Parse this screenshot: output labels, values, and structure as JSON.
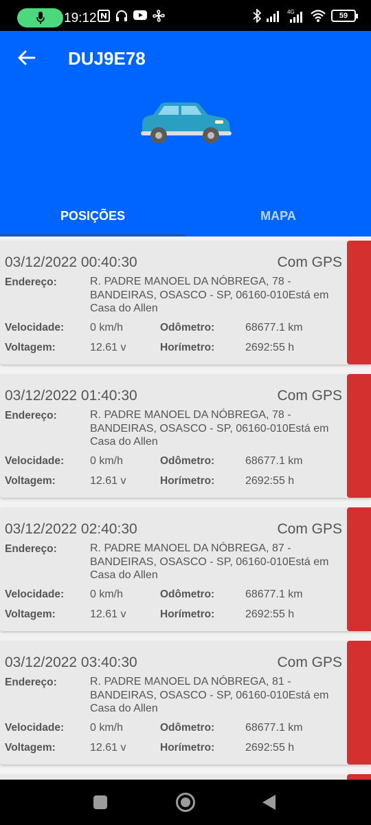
{
  "status_bar": {
    "time": "19:12",
    "battery": "59",
    "network": "4G",
    "icons_left": [
      "nfc-icon",
      "headset-icon",
      "youtube-icon",
      "fan-icon"
    ],
    "icons_right": [
      "bluetooth-icon",
      "signal-icon",
      "signal-4g-icon",
      "wifi-icon",
      "battery-icon"
    ]
  },
  "header": {
    "title": "DUJ9E78",
    "car_color": "#2a9fc2"
  },
  "tabs": [
    {
      "label": "POSIÇÕES",
      "active": true
    },
    {
      "label": "MAPA",
      "active": false
    }
  ],
  "labels": {
    "address": "Endereço:",
    "speed": "Velocidade:",
    "odometer": "Odômetro:",
    "voltage": "Voltagem:",
    "hourmeter": "Horímetro:"
  },
  "positions": [
    {
      "datetime": "03/12/2022 00:40:30",
      "gps": "Com GPS",
      "address": "R. PADRE MANOEL DA NÓBREGA, 78 - BANDEIRAS, OSASCO - SP, 06160-010Está em Casa do Allen",
      "speed": "0 km/h",
      "odometer": "68677.1 km",
      "voltage": "12.61 v",
      "hourmeter": "2692:55 h"
    },
    {
      "datetime": "03/12/2022 01:40:30",
      "gps": "Com GPS",
      "address": "R. PADRE MANOEL DA NÓBREGA, 78 - BANDEIRAS, OSASCO - SP, 06160-010Está em Casa do Allen",
      "speed": "0 km/h",
      "odometer": "68677.1 km",
      "voltage": "12.61 v",
      "hourmeter": "2692:55 h"
    },
    {
      "datetime": "03/12/2022 02:40:30",
      "gps": "Com GPS",
      "address": "R. PADRE MANOEL DA NÓBREGA, 87 - BANDEIRAS, OSASCO - SP, 06160-010Está em Casa do Allen",
      "speed": "0 km/h",
      "odometer": "68677.1 km",
      "voltage": "12.61 v",
      "hourmeter": "2692:55 h"
    },
    {
      "datetime": "03/12/2022 03:40:30",
      "gps": "Com GPS",
      "address": "R. PADRE MANOEL DA NÓBREGA, 81 - BANDEIRAS, OSASCO - SP, 06160-010Está em Casa do Allen",
      "speed": "0 km/h",
      "odometer": "68677.1 km",
      "voltage": "12.61 v",
      "hourmeter": "2692:55 h"
    }
  ],
  "colors": {
    "header_bg": "#0064ff",
    "status_stripe": "#d53030",
    "card_bg": "#e9e9e9"
  }
}
